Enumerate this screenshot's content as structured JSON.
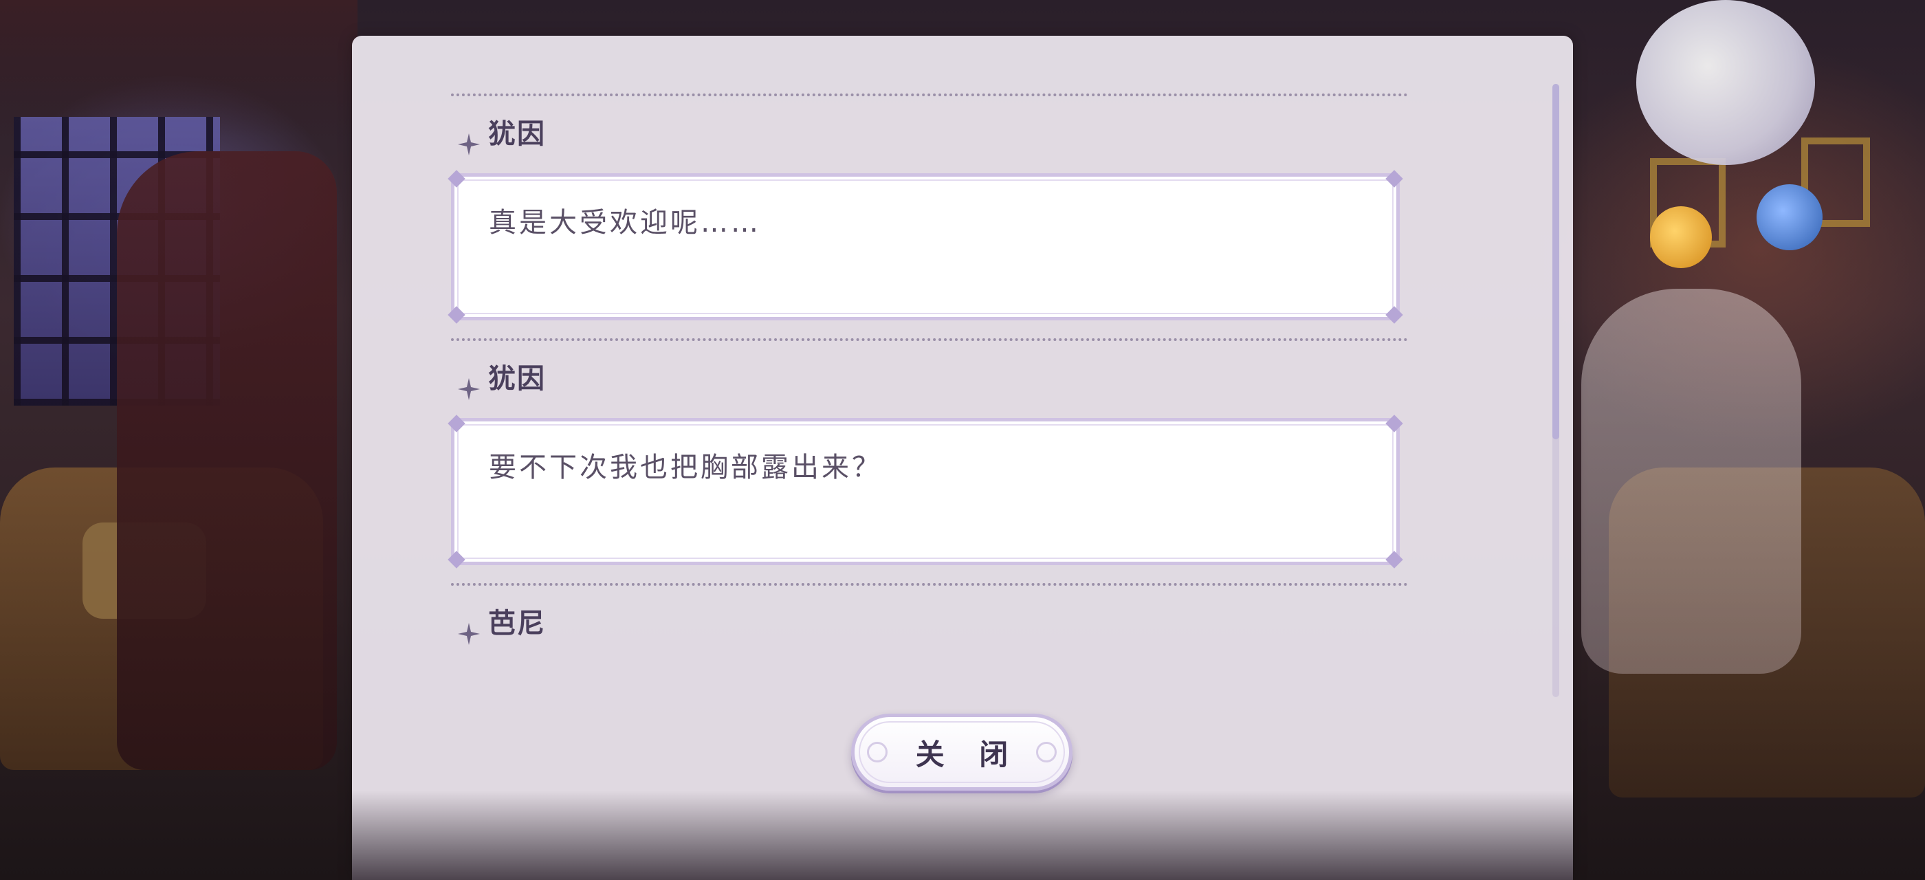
{
  "dialogue_log": {
    "entries": [
      {
        "speaker": "犹因",
        "text": "真是大受欢迎呢……"
      },
      {
        "speaker": "犹因",
        "text": "要不下次我也把胸部露出来？"
      },
      {
        "speaker": "芭尼",
        "text": ""
      }
    ]
  },
  "close_button": {
    "label": "关 闭"
  },
  "scroll": {
    "position_fraction": 0.0,
    "visible_fraction": 0.58
  },
  "colors": {
    "panel_bg": "#ECE6EE",
    "bubble_border": "#CFC2E3",
    "speaker_text": "#4A3F5C",
    "dialogue_text": "#5A5066",
    "scroll_thumb": "#B9B0D8"
  },
  "icons": {
    "speaker_marker": "four-point-star-icon"
  }
}
